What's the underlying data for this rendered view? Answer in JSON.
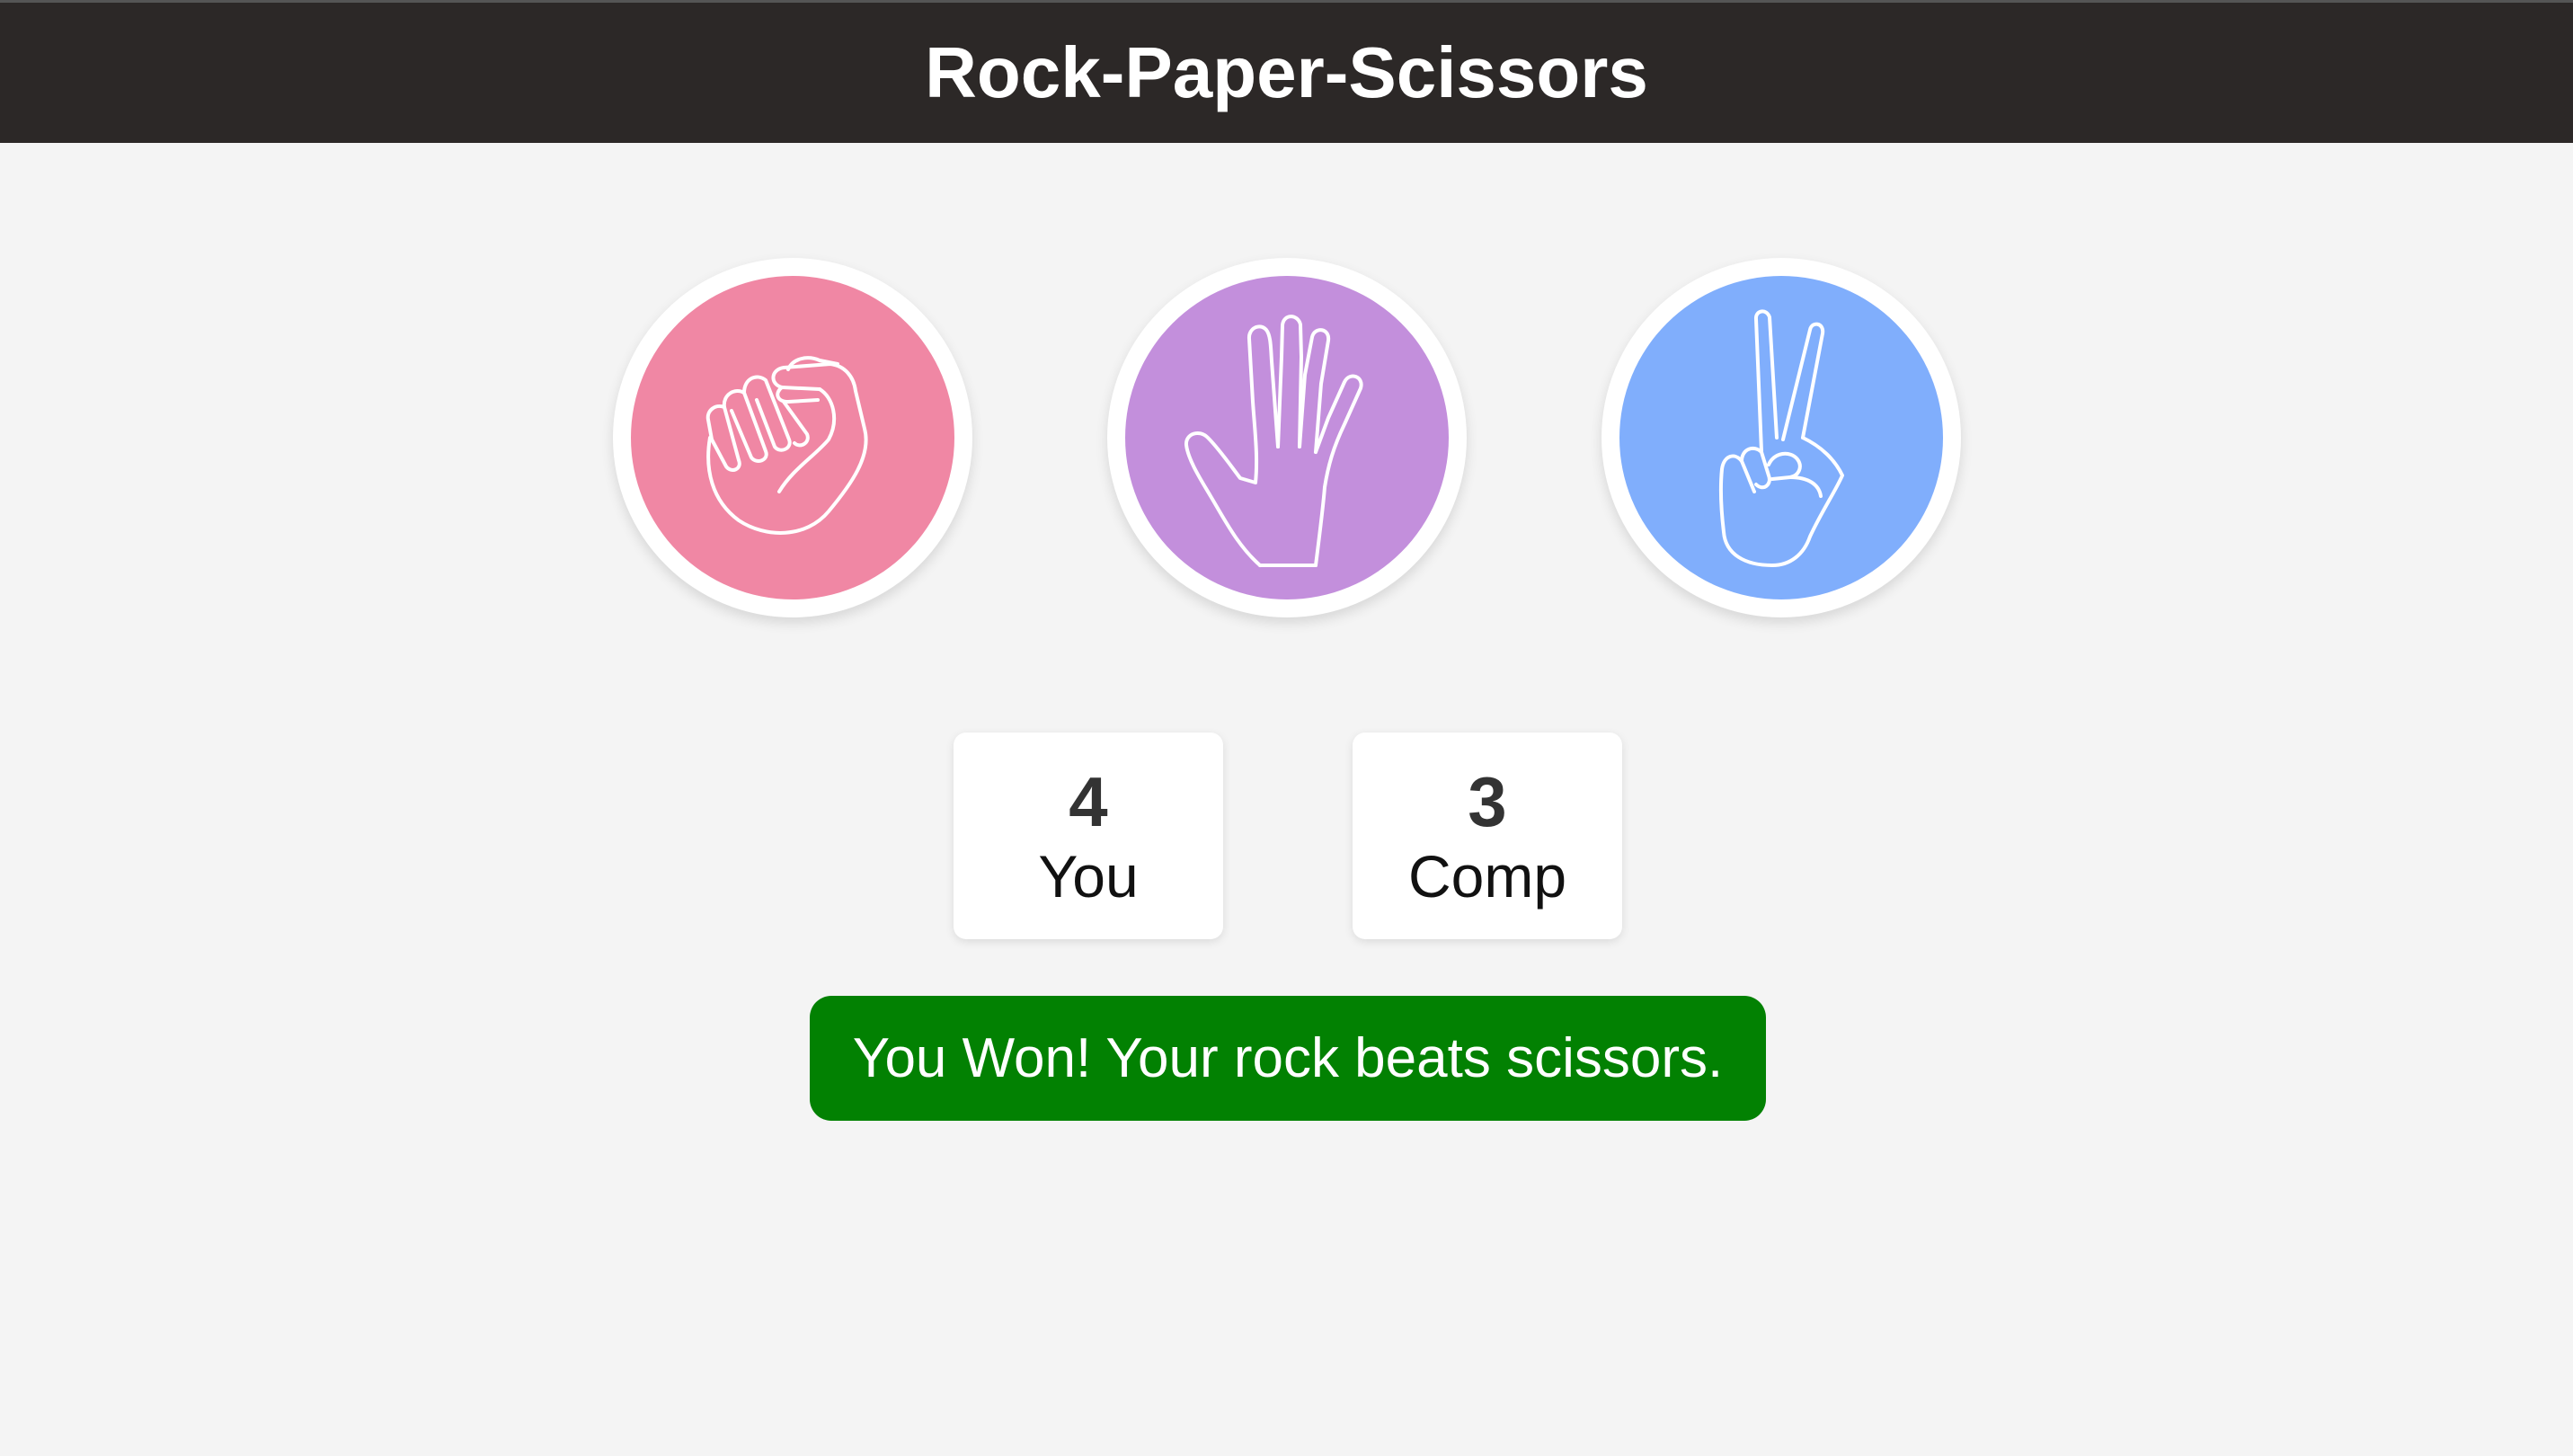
{
  "header": {
    "title": "Rock-Paper-Scissors"
  },
  "choices": [
    {
      "id": "rock",
      "icon": "fist-icon",
      "color": "#f087a4"
    },
    {
      "id": "paper",
      "icon": "open-hand-icon",
      "color": "#c38fdc"
    },
    {
      "id": "scissors",
      "icon": "peace-hand-icon",
      "color": "#80aefc"
    }
  ],
  "scores": {
    "user": {
      "value": "4",
      "label": "You"
    },
    "comp": {
      "value": "3",
      "label": "Comp"
    }
  },
  "result": {
    "text": "You Won! Your rock beats scissors.",
    "color": "#028102"
  },
  "colors": {
    "header_bg": "#2c2827",
    "page_bg": "#f4f4f4"
  }
}
